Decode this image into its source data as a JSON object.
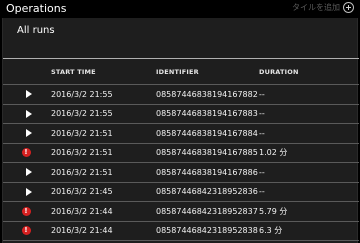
{
  "header": {
    "title": "Operations",
    "add_tile_label": "タイルを追加"
  },
  "tile": {
    "subtitle": "All runs"
  },
  "table": {
    "columns": [
      "START TIME",
      "IDENTIFIER",
      "DURATION"
    ],
    "rows": [
      {
        "status": "play-icon",
        "start": "2016/3/2 21:55",
        "id": "08587446838194167882",
        "duration": "--"
      },
      {
        "status": "play-icon",
        "start": "2016/3/2 21:55",
        "id": "08587446838194167883",
        "duration": "--"
      },
      {
        "status": "play-icon",
        "start": "2016/3/2 21:51",
        "id": "08587446838194167884",
        "duration": "--"
      },
      {
        "status": "error-icon",
        "start": "2016/3/2 21:51",
        "id": "08587446838194167885",
        "duration": "1.02 分"
      },
      {
        "status": "play-icon",
        "start": "2016/3/2 21:51",
        "id": "08587446838194167886",
        "duration": "--"
      },
      {
        "status": "play-icon",
        "start": "2016/3/2 21:45",
        "id": "08587446842318952836",
        "duration": "--"
      },
      {
        "status": "error-icon",
        "start": "2016/3/2 21:44",
        "id": "08587446842318952837",
        "duration": "5.79 分"
      },
      {
        "status": "error-icon",
        "start": "2016/3/2 21:44",
        "id": "08587446842318952838",
        "duration": "6.3 分"
      }
    ]
  },
  "colors": {
    "background": "#1e1e1e",
    "error": "#d62020"
  }
}
